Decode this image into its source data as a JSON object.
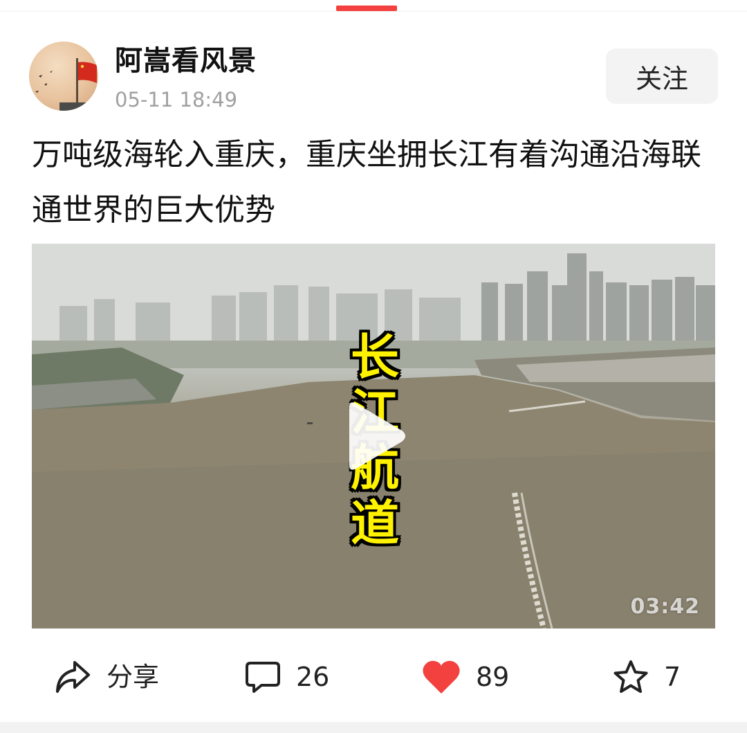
{
  "colors": {
    "accent": "#f2413f",
    "like": "#f2413f",
    "secondary_text": "#a0a0a0",
    "follow_bg": "#f3f3f3"
  },
  "author": {
    "name": "阿嵩看风景",
    "timestamp": "05-11 18:49",
    "avatar_icon": "flag-avatar-icon"
  },
  "follow_button": {
    "label": "关注"
  },
  "post": {
    "title": "万吨级海轮入重庆，重庆坐拥长江有着沟通沿海联通世界的巨大优势"
  },
  "video": {
    "overlay_chars": [
      "长",
      "江",
      "航",
      "道"
    ],
    "watermark": "03:42",
    "play_icon": "play-icon"
  },
  "actions": {
    "share": {
      "icon": "share-arrow-icon",
      "label": "分享"
    },
    "comment": {
      "icon": "comment-bubble-icon",
      "count": "26"
    },
    "like": {
      "icon": "heart-icon",
      "count": "89"
    },
    "favorite": {
      "icon": "star-icon",
      "count": "7"
    }
  }
}
